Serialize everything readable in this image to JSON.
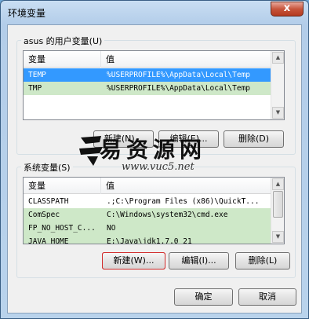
{
  "window": {
    "title": "环境变量",
    "close_label": "x"
  },
  "user_vars": {
    "label": "asus 的用户变量(U)",
    "col_variable": "变量",
    "col_value": "值",
    "rows": [
      {
        "name": "TEMP",
        "value": "%USERPROFILE%\\AppData\\Local\\Temp"
      },
      {
        "name": "TMP",
        "value": "%USERPROFILE%\\AppData\\Local\\Temp"
      }
    ],
    "new_label": "新建(N)...",
    "edit_label": "编辑(E)...",
    "delete_label": "删除(D)"
  },
  "system_vars": {
    "label": "系统变量(S)",
    "col_variable": "变量",
    "col_value": "值",
    "rows": [
      {
        "name": "CLASSPATH",
        "value": ".;C:\\Program Files (x86)\\QuickT..."
      },
      {
        "name": "ComSpec",
        "value": "C:\\Windows\\system32\\cmd.exe"
      },
      {
        "name": "FP_NO_HOST_C...",
        "value": "NO"
      },
      {
        "name": "JAVA_HOME",
        "value": "E:\\Java\\jdk1.7.0_21"
      }
    ],
    "new_label": "新建(W)...",
    "edit_label": "编辑(I)...",
    "delete_label": "删除(L)"
  },
  "footer": {
    "ok_label": "确定",
    "cancel_label": "取消"
  },
  "watermark": {
    "text": "易资源网",
    "url": "www.vuc5.net"
  }
}
